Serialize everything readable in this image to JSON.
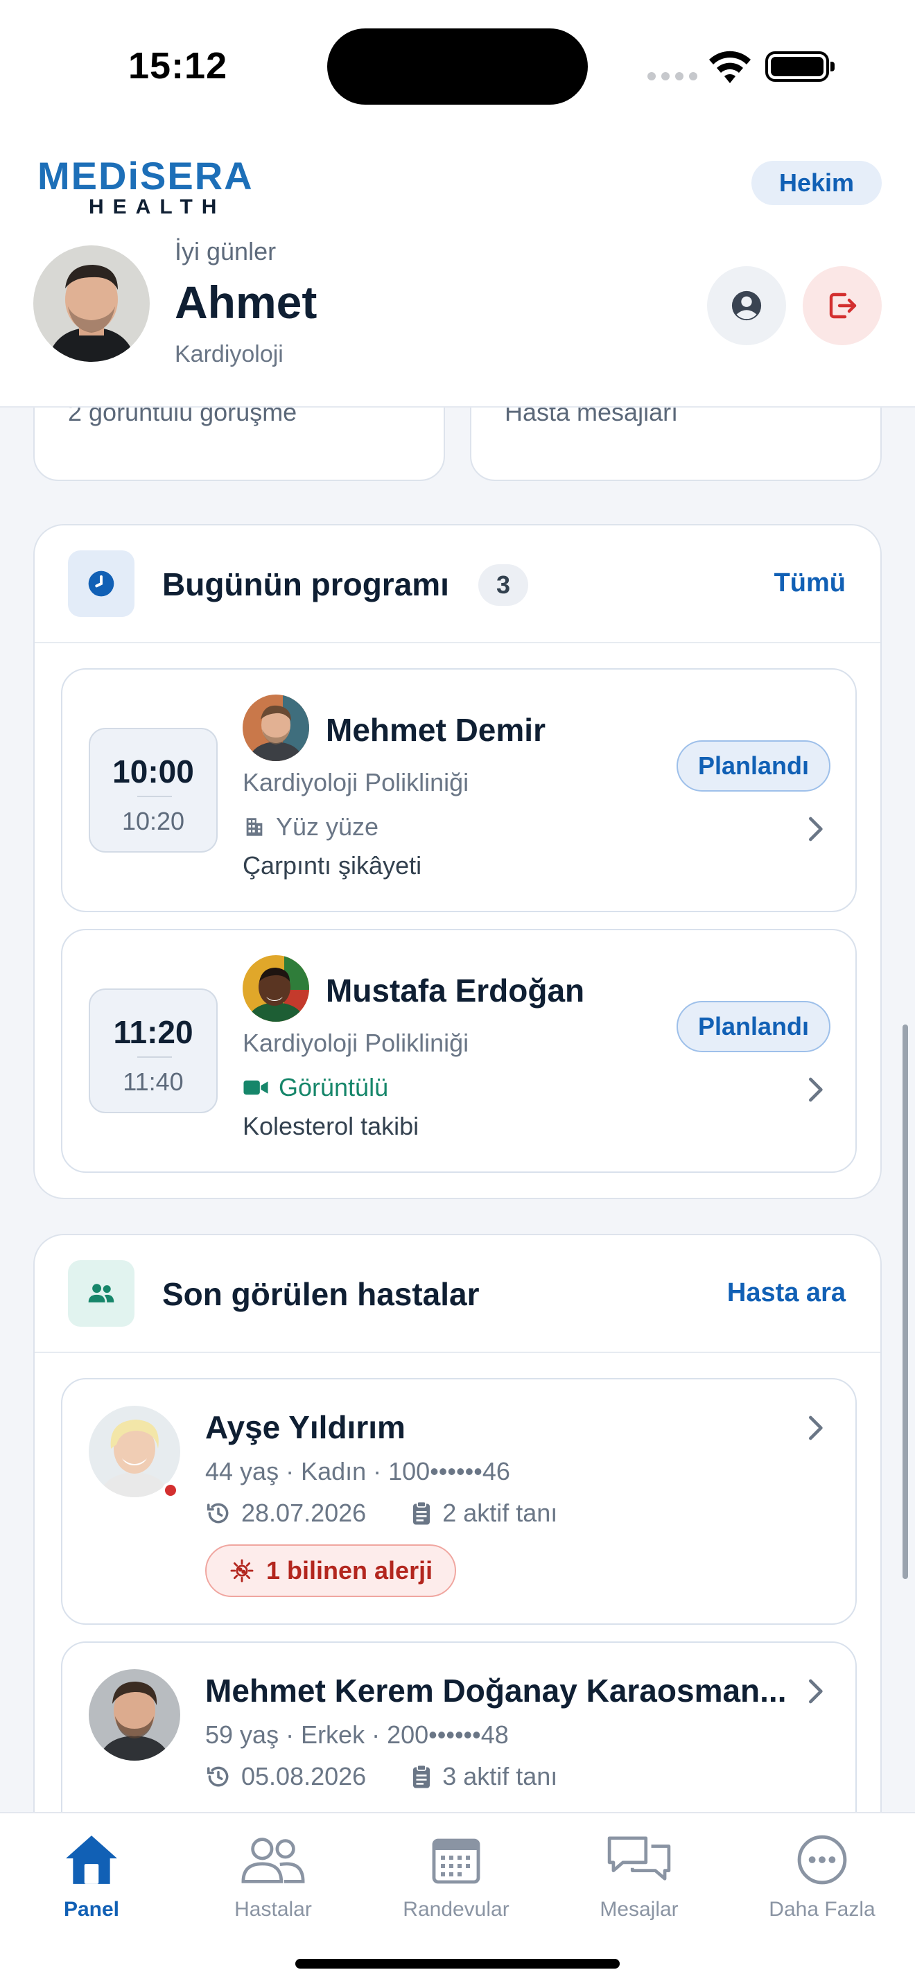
{
  "status_bar": {
    "time": "15:12"
  },
  "header": {
    "logo_top": "MEDiSERA",
    "logo_bottom": "HEALTH",
    "role_badge": "Hekim",
    "greeting": "İyi günler",
    "user_name": "Ahmet",
    "specialty": "Kardiyoloji"
  },
  "stats": {
    "left_text": "2 görüntülü görüşme",
    "right_text": "Hasta mesajları"
  },
  "schedule": {
    "title": "Bugünün programı",
    "count": "3",
    "link": "Tümü",
    "appointments": [
      {
        "start": "10:00",
        "end": "10:20",
        "patient": "Mehmet Demir",
        "department": "Kardiyoloji Polikliniği",
        "type": "Yüz yüze",
        "type_icon": "building-icon",
        "note": "Çarpıntı şikâyeti",
        "status": "Planlandı"
      },
      {
        "start": "11:20",
        "end": "11:40",
        "patient": "Mustafa Erdoğan",
        "department": "Kardiyoloji Polikliniği",
        "type": "Görüntülü",
        "type_icon": "video-icon",
        "note": "Kolesterol takibi",
        "status": "Planlandı"
      }
    ]
  },
  "recent_patients": {
    "title": "Son görülen hastalar",
    "link": "Hasta ara",
    "patients": [
      {
        "name": "Ayşe Yıldırım",
        "meta": "44 yaş · Kadın · 100••••••46",
        "last_visit": "28.07.2026",
        "diagnoses": "2 aktif tanı",
        "allergy": "1 bilinen alerji"
      },
      {
        "name": "Mehmet Kerem Doğanay Karaosman...",
        "meta": "59 yaş · Erkek · 200••••••48",
        "last_visit": "05.08.2026",
        "diagnoses": "3 aktif tanı"
      }
    ]
  },
  "tabs": [
    {
      "label": "Panel",
      "icon": "home-icon",
      "active": true
    },
    {
      "label": "Hastalar",
      "icon": "users-icon"
    },
    {
      "label": "Randevular",
      "icon": "calendar-icon"
    },
    {
      "label": "Mesajlar",
      "icon": "chat-icon"
    },
    {
      "label": "Daha Fazla",
      "icon": "more-icon"
    }
  ],
  "colors": {
    "accent": "#1160b5",
    "danger": "#d32f2f",
    "teal": "#16866a",
    "background": "#f3f5f9"
  }
}
